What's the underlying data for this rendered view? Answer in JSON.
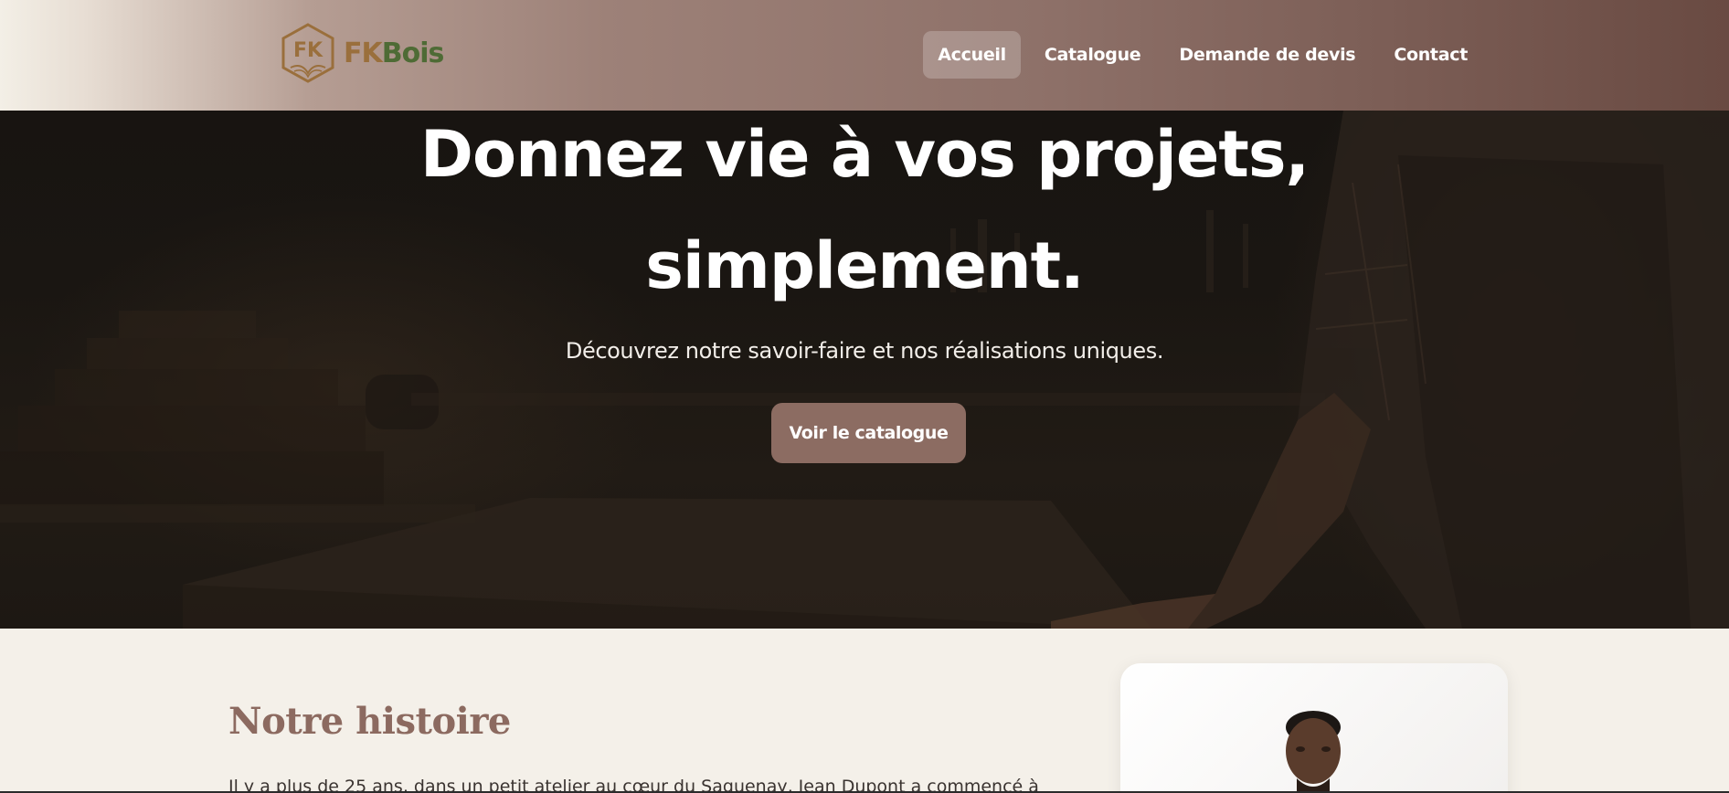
{
  "brand": {
    "monogram": "FK",
    "name_part1": "FK",
    "name_part2": "Bois",
    "colors": {
      "gold": "#9a6f3c",
      "green": "#4e6b35"
    }
  },
  "nav": {
    "items": [
      {
        "label": "Accueil",
        "active": true
      },
      {
        "label": "Catalogue",
        "active": false
      },
      {
        "label": "Demande de devis",
        "active": false
      },
      {
        "label": "Contact",
        "active": false
      }
    ]
  },
  "hero": {
    "title_line1": "Donnez vie à vos projets,",
    "title_line2": "simplement.",
    "subtitle": "Découvrez notre savoir-faire et nos réalisations uniques.",
    "cta_label": "Voir le catalogue",
    "accent_color": "#8c6c62"
  },
  "about": {
    "title": "Notre histoire",
    "text": "Il y a plus de 25 ans, dans un petit atelier au cœur du Saguenay, Jean Dupont a commencé à"
  }
}
